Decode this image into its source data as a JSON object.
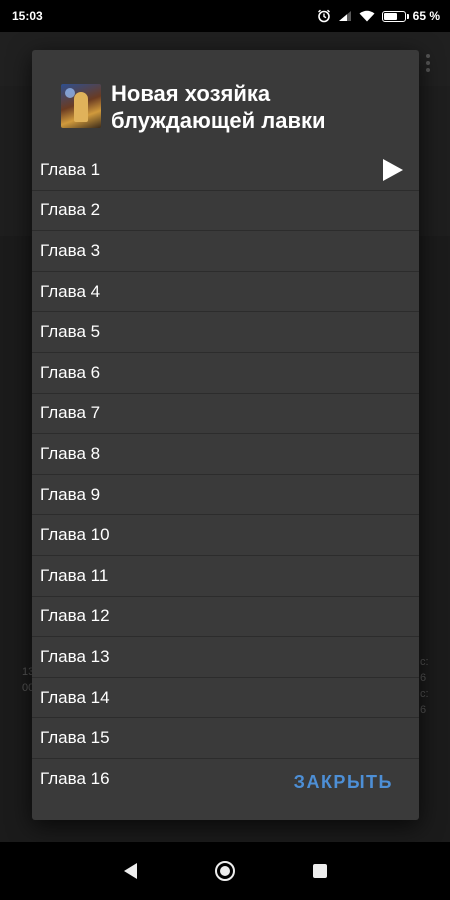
{
  "status_bar": {
    "time": "15:03",
    "battery_text": "65 %",
    "battery_level": 0.65,
    "icons": [
      "alarm-icon",
      "signal-icon",
      "wifi-icon",
      "battery-icon"
    ]
  },
  "dialog": {
    "title": "Новая хозяйка блуждающей лавки",
    "cover_icon": "book-cover-icon",
    "chapters": [
      "Глава 1",
      "Глава 2",
      "Глава 3",
      "Глава 4",
      "Глава 5",
      "Глава 6",
      "Глава 7",
      "Глава 8",
      "Глава 9",
      "Глава 10",
      "Глава 11",
      "Глава 12",
      "Глава 13",
      "Глава 14",
      "Глава 15",
      "Глава 16"
    ],
    "now_playing_index": 0,
    "close_label": "ЗАКРЫТЬ"
  },
  "background": {
    "left_fragments": [
      "13",
      "00"
    ],
    "right_fragments": [
      "с:",
      "6",
      "с:",
      "6"
    ]
  },
  "nav_bar": {
    "buttons": [
      "back-icon",
      "home-icon",
      "recents-icon"
    ]
  },
  "colors": {
    "dialog_bg": "#3a3a3a",
    "accent": "#4d8fd6",
    "status_bar_bg": "#000000"
  }
}
